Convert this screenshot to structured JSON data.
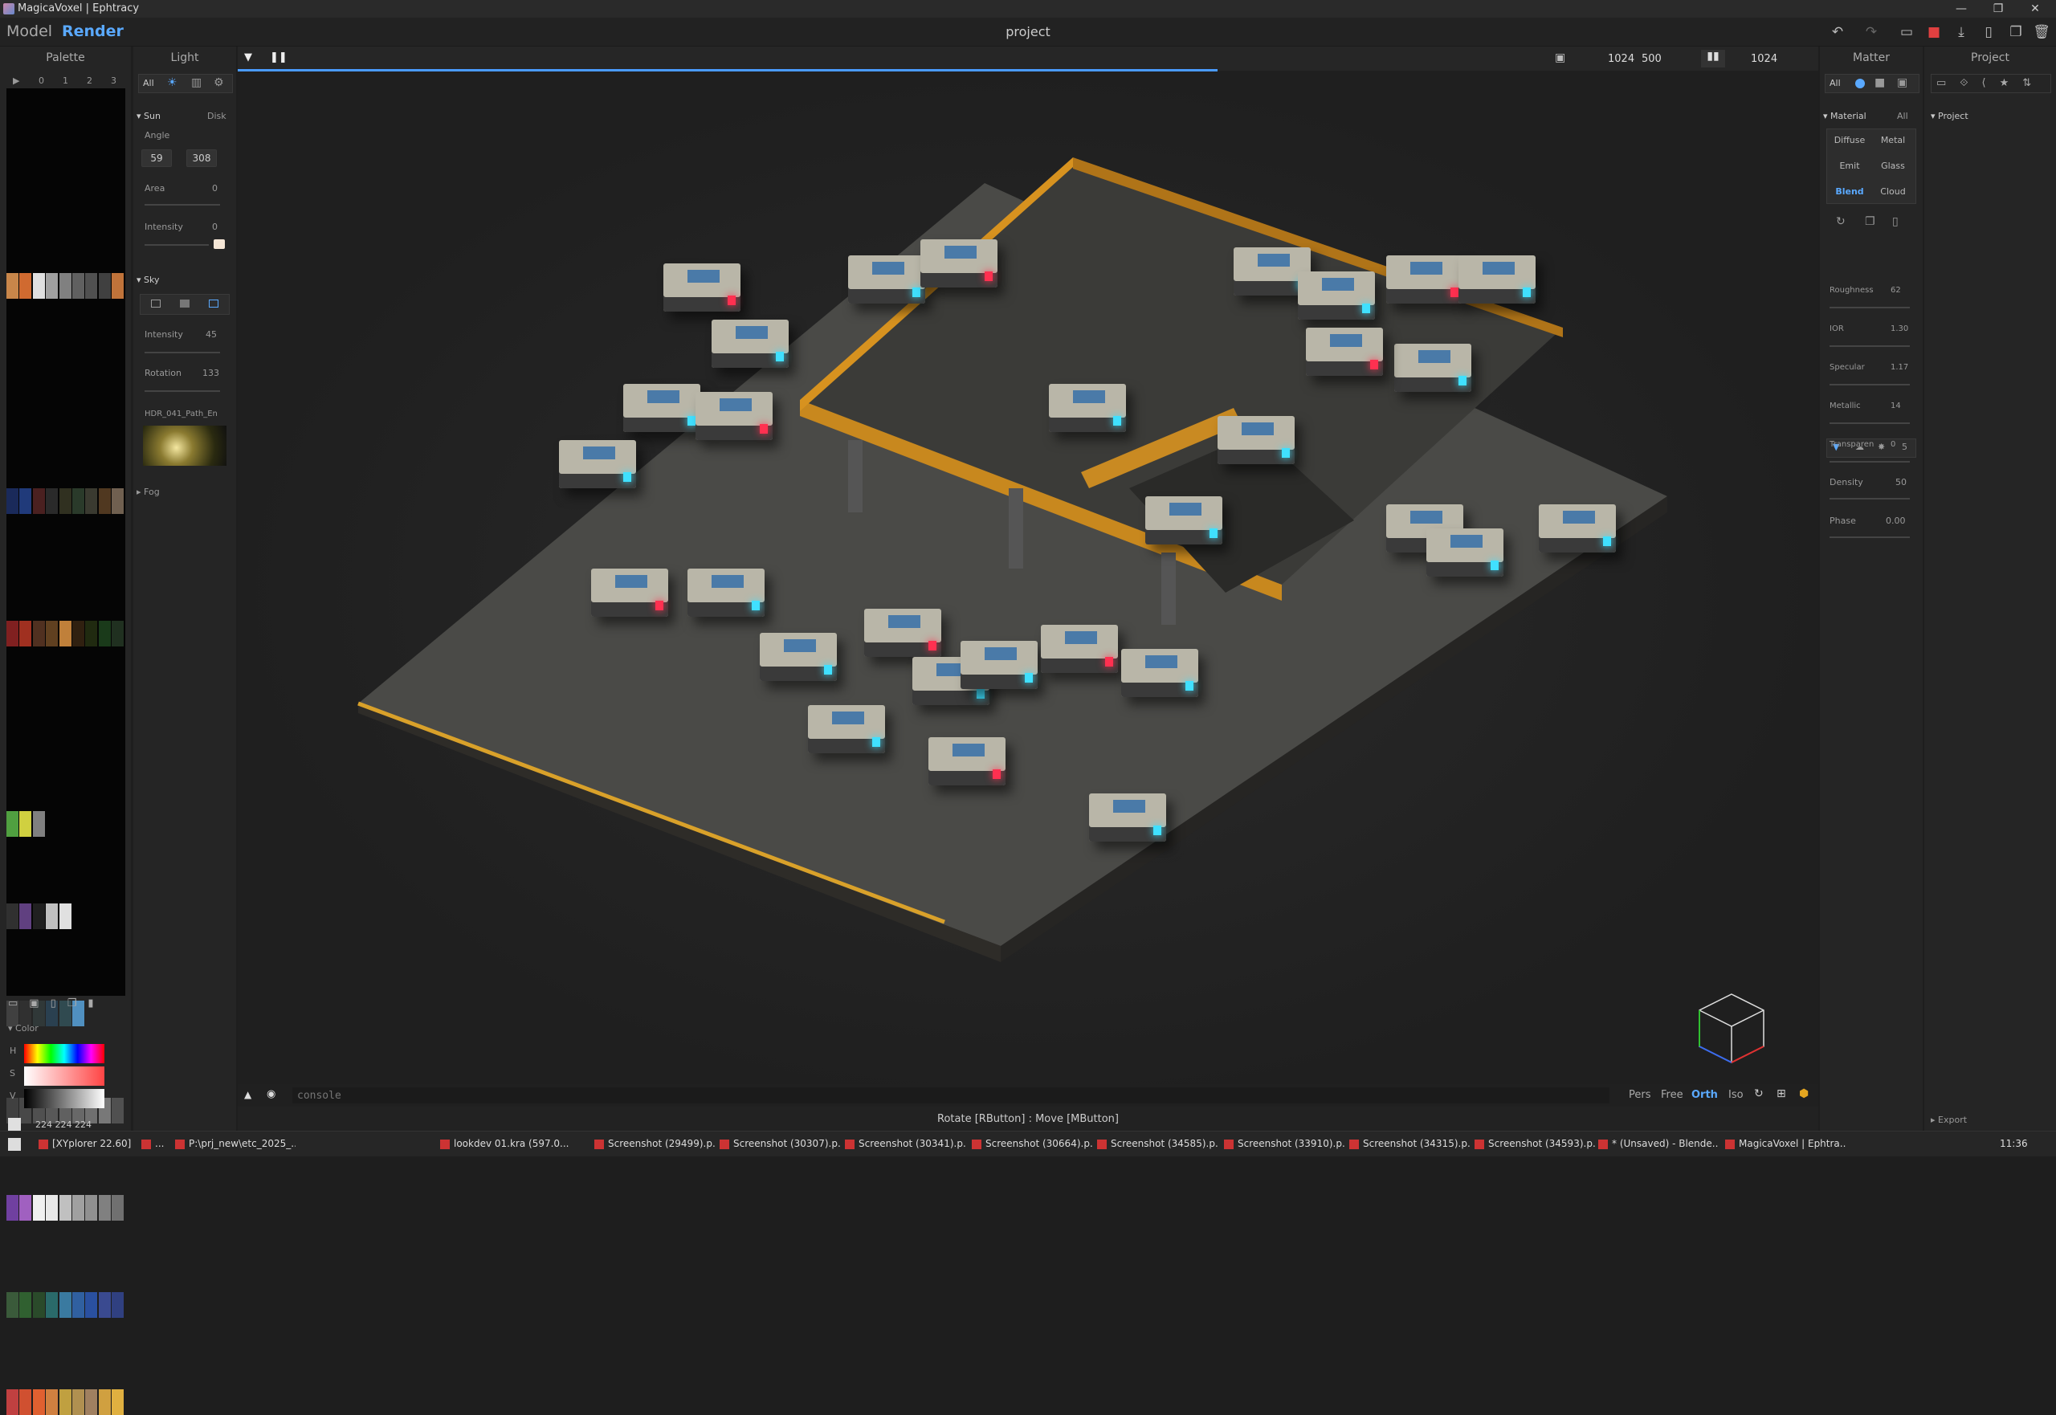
{
  "window": {
    "title": "MagicaVoxel | Ephtracy",
    "controls": [
      "—",
      "❐",
      "✕"
    ]
  },
  "menubar": {
    "mode_model": "Model",
    "mode_render": "Render",
    "project_title": "project"
  },
  "toolbar_icons": [
    "undo-icon",
    "redo-icon",
    "open-icon",
    "save-icon",
    "export-icon",
    "new-icon",
    "copy-icon",
    "delete-icon"
  ],
  "palette": {
    "title": "Palette",
    "pages": [
      "▶",
      "0",
      "1",
      "2",
      "3"
    ],
    "color_label": "Color",
    "hsv_labels": [
      "H",
      "S",
      "V"
    ],
    "rgb_value": "224  224  224"
  },
  "light": {
    "title": "Light",
    "tabs": [
      "All"
    ],
    "sun": {
      "label": "Sun",
      "mode": "Disk",
      "angle_label": "Angle",
      "angle_a": "59",
      "angle_b": "308",
      "area_label": "Area",
      "area_value": "0",
      "intensity_label": "Intensity",
      "intensity_value": "0"
    },
    "sky": {
      "label": "Sky",
      "intensity_label": "Intensity",
      "intensity_value": "45",
      "rotation_label": "Rotation",
      "rotation_value": "133",
      "hdr_name": "HDR_041_Path_En"
    },
    "fog_label": "Fog"
  },
  "viewport": {
    "res_w": "1024",
    "res_h": "500",
    "samples": "1024",
    "console_placeholder": "console",
    "cams": [
      "Pers",
      "Free",
      "Orth",
      "Iso"
    ],
    "active_cam": "Orth",
    "status": "Rotate [RButton] : Move [MButton]",
    "progress": 0.62
  },
  "matter": {
    "title": "Matter",
    "tab_all": "All",
    "material_label": "Material",
    "material_scope": "All",
    "types": [
      "Diffuse",
      "Metal",
      "Emit",
      "Glass",
      "Blend",
      "Cloud"
    ],
    "active_type": "Blend",
    "props": [
      {
        "label": "Roughness",
        "value": "62"
      },
      {
        "label": "IOR",
        "value": "1.30"
      },
      {
        "label": "Specular",
        "value": "1.17"
      },
      {
        "label": "Metallic",
        "value": "14"
      },
      {
        "label": "Transparen",
        "value": "0"
      }
    ],
    "media_count": "5",
    "density": {
      "label": "Density",
      "value": "50"
    },
    "phase": {
      "label": "Phase",
      "value": "0.00"
    }
  },
  "project": {
    "title": "Project",
    "section": "Project",
    "export_label": "Export"
  },
  "taskbar": {
    "items": [
      "[XYplorer 22.60]",
      "...",
      "P:\\prj_new\\etc_2025_...",
      "lookdev 01.kra (597.0...",
      "Screenshot (29499).p...",
      "Screenshot (30307).p...",
      "Screenshot (30341).p...",
      "Screenshot (30664).p...",
      "Screenshot (34585).p...",
      "Screenshot (33910).p...",
      "Screenshot (34315).p...",
      "Screenshot (34593).p...",
      "* (Unsaved) - Blende...",
      "MagicaVoxel | Ephtra..."
    ],
    "clock": "11:36"
  }
}
